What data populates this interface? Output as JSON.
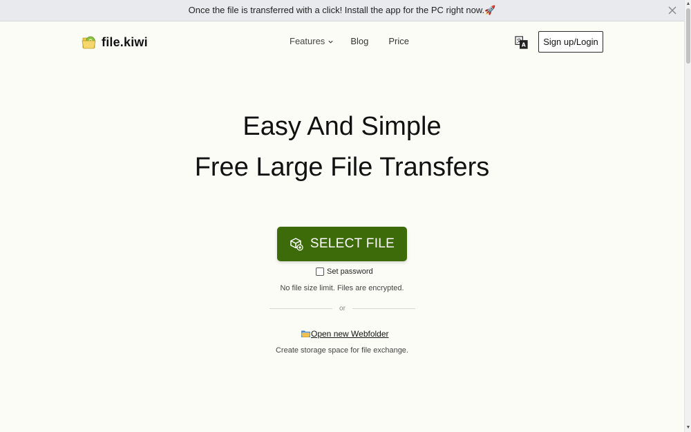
{
  "banner": {
    "text": "Once the file is transferred with a click! Install the app for the PC right now.🚀",
    "close_icon": "close-icon"
  },
  "header": {
    "logo_text": "file.kiwi",
    "logo_icon": "kiwi-folder-icon",
    "nav": {
      "features": "Features",
      "blog": "Blog",
      "price": "Price"
    },
    "language_icon": "translate-icon",
    "login_label": "Sign up/Login"
  },
  "hero": {
    "line1": "Easy And Simple",
    "line2": "Free Large File Transfers"
  },
  "upload": {
    "select_label": "SELECT FILE",
    "select_icon": "package-add-icon",
    "password_label": "Set password",
    "password_checked": false,
    "limit_text": "No file size limit. Files are encrypted.",
    "divider_text": "or",
    "webfolder_label": "Open new Webfolder",
    "webfolder_icon": "folder-icon",
    "storage_text": "Create storage space for file exchange."
  },
  "colors": {
    "background": "#fcfcf6",
    "primary_button": "#3d6b0a",
    "banner": "#e9eaee"
  }
}
